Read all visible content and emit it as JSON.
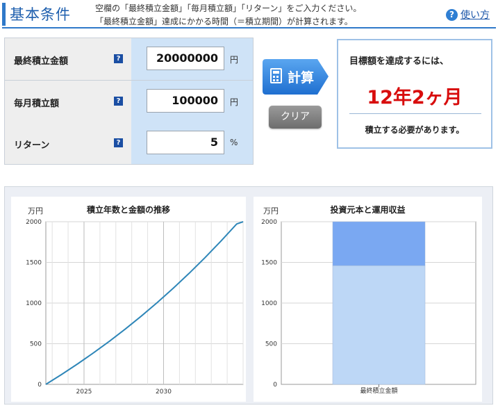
{
  "header": {
    "title": "基本条件",
    "note_line1": "空欄の「最終積立金額」「毎月積立額」「リターン」をご入力ください。",
    "note_line2": "「最終積立金額」達成にかかる時間（＝積立期間）が計算されます。",
    "help_label": "使い方"
  },
  "form": {
    "help_mark": "?",
    "rows": [
      {
        "label": "最終積立金額",
        "value": "20000000",
        "unit": "円"
      },
      {
        "label": "毎月積立額",
        "value": "100000",
        "unit": "円"
      },
      {
        "label": "リターン",
        "value": "5",
        "unit": "%"
      }
    ]
  },
  "buttons": {
    "calculate": "計算",
    "clear": "クリア"
  },
  "result": {
    "heading": "目標額を達成するには、",
    "value": "12年2ヶ月",
    "footer": "積立する必要があります。"
  },
  "colors": {
    "accent": "#2f79c9",
    "result_red": "#d80d0d",
    "line_series": "#2e86b8",
    "bar_principal": "#bdd7f6",
    "bar_gain": "#7aa8f2"
  },
  "chart_data": [
    {
      "type": "line",
      "title": "積立年数と金額の推移",
      "ylabel": "万円",
      "xlabel": "",
      "ylim": [
        0,
        2000
      ],
      "yticks": [
        0,
        500,
        1000,
        1500,
        2000
      ],
      "xticks": [
        "2025",
        "2030"
      ],
      "grid": true,
      "x_range_years": [
        2022.6,
        2035.0
      ],
      "series": [
        {
          "x": [
            2022.6,
            2023.6,
            2024.6,
            2025.6,
            2026.6,
            2027.6,
            2028.6,
            2029.6,
            2030.6,
            2031.6,
            2032.6,
            2033.6,
            2034.6,
            2035.0
          ],
          "values": [
            0,
            123,
            252,
            388,
            531,
            681,
            839,
            1005,
            1180,
            1364,
            1557,
            1760,
            1973,
            2000
          ]
        }
      ]
    },
    {
      "type": "bar",
      "stacked": true,
      "title": "投資元本と運用収益",
      "ylabel": "万円",
      "categories": [
        "最終積立金額"
      ],
      "ylim": [
        0,
        2000
      ],
      "yticks": [
        0,
        500,
        1000,
        1500,
        2000
      ],
      "grid": true,
      "series": [
        {
          "values": [
            1460
          ]
        },
        {
          "values": [
            540
          ]
        }
      ]
    }
  ]
}
